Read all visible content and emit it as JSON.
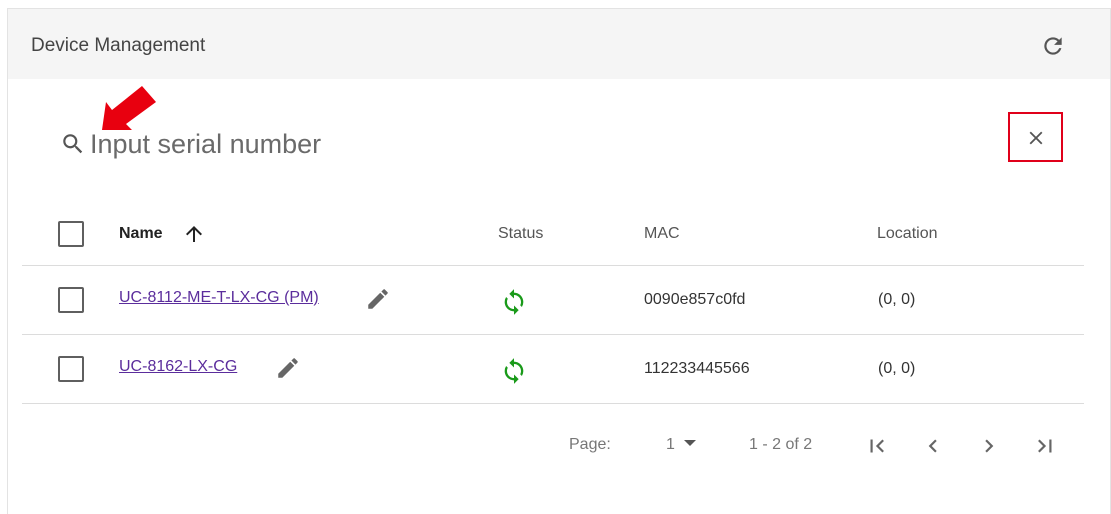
{
  "header": {
    "title": "Device Management",
    "refresh_icon": "refresh-icon"
  },
  "search": {
    "placeholder": "Input serial number",
    "value": "",
    "icon": "search-icon",
    "clear_icon": "close-icon"
  },
  "annotations": {
    "arrow_color": "#e8000f",
    "highlight_color": "#e0001a"
  },
  "table": {
    "columns": {
      "name": "Name",
      "status": "Status",
      "mac": "MAC",
      "location": "Location"
    },
    "sort": "ascending",
    "rows": [
      {
        "name": "UC-8112-ME-T-LX-CG (PM)",
        "status_icon": "sync-icon",
        "mac": "0090e857c0fd",
        "location": "(0, 0)"
      },
      {
        "name": "UC-8162-LX-CG",
        "status_icon": "sync-icon",
        "mac": "112233445566",
        "location": "(0, 0)"
      }
    ]
  },
  "pagination": {
    "page_label": "Page:",
    "current_page": "1",
    "range_text": "1 - 2 of 2"
  },
  "colors": {
    "link": "#5b2d9c",
    "status_green": "#1a9a1a",
    "header_bg": "#f5f5f5"
  }
}
